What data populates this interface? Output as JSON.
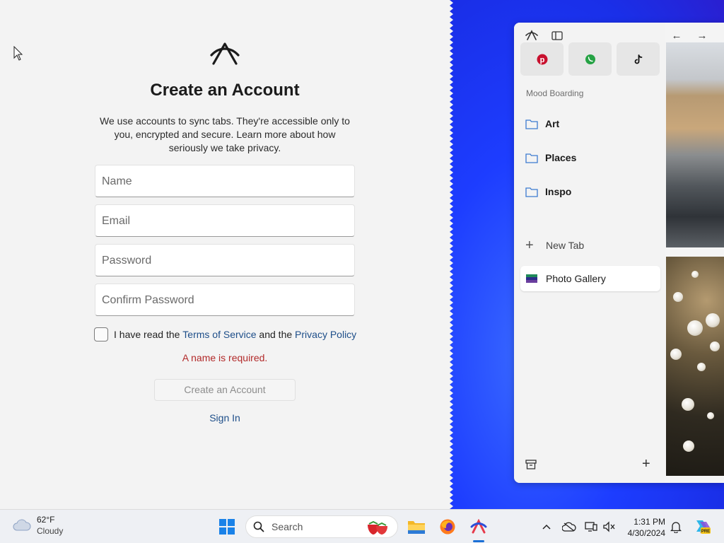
{
  "signup": {
    "title": "Create an Account",
    "description": "We use accounts to sync tabs. They're accessible only to you, encrypted and secure. Learn more about how seriously we take privacy.",
    "fields": {
      "name_placeholder": "Name",
      "email_placeholder": "Email",
      "password_placeholder": "Password",
      "confirm_placeholder": "Confirm Password"
    },
    "terms": {
      "prefix": "I have read the ",
      "tos": "Terms of Service",
      "middle": " and the ",
      "privacy": "Privacy Policy",
      "checked": false
    },
    "error": "A name is required.",
    "create_button": "Create an Account",
    "sign_in": "Sign In"
  },
  "browser": {
    "pinned": [
      "pinterest-icon",
      "whatsapp-icon",
      "tiktok-icon"
    ],
    "space_name": "Mood Boarding",
    "folders": [
      "Art",
      "Places",
      "Inspo"
    ],
    "new_tab": "New Tab",
    "tabs": [
      "Photo Gallery"
    ]
  },
  "taskbar": {
    "weather_temp": "62°F",
    "weather_cond": "Cloudy",
    "search_label": "Search",
    "time": "1:31 PM",
    "date": "4/30/2024"
  },
  "colors": {
    "accent_link": "#1d4e89",
    "error": "#b22a2a",
    "desktop_blue": "#1d3dff"
  }
}
